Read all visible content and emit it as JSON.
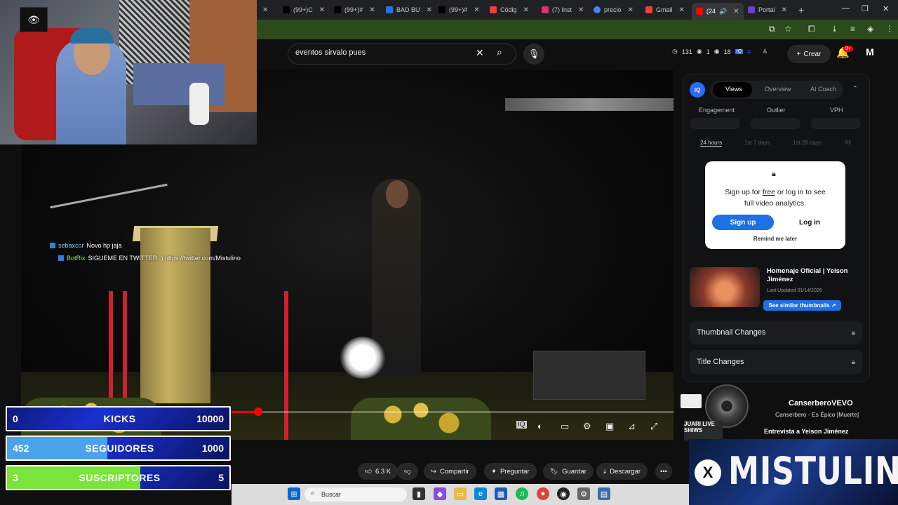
{
  "browser": {
    "tabs": [
      {
        "label": "(99+)C",
        "color": "#000000"
      },
      {
        "label": "(99+)#",
        "color": "#000000"
      },
      {
        "label": "BAD BU",
        "color": "#1877f2"
      },
      {
        "label": "(99+)#",
        "color": "#000000"
      },
      {
        "label": "Códig",
        "color": "#ea4335"
      },
      {
        "label": "(7) Inst",
        "color": "#e1306c"
      },
      {
        "label": "precio",
        "color": "#4285f4"
      },
      {
        "label": "Gmail",
        "color": "#ea4335"
      },
      {
        "label": "(24",
        "color": "#ff0000"
      },
      {
        "label": "Portal",
        "color": "#6a3fd0"
      }
    ]
  },
  "youtube": {
    "search_value": "eventos sirvalo pues",
    "stats": {
      "views": "131",
      "sep1": "1",
      "sep2": "18"
    },
    "create_label": "Crear",
    "notif_badge": "9+",
    "actions": {
      "likes": "6.3 K",
      "share": "Compartir",
      "ask": "Preguntar",
      "save": "Guardar",
      "download": "Descargar",
      "more": "•••"
    },
    "progress": 0.06
  },
  "chat": [
    {
      "user": "sebaxcor",
      "message": "Novo hp jaja"
    },
    {
      "user": "BotRix",
      "message": "SIGUEME EN TWITTER :) https://twitter.com/Mistulino"
    }
  ],
  "panel": {
    "logo": "IQ",
    "tabs": [
      "Views",
      "Overview",
      "AI Coach"
    ],
    "metrics": [
      "Engagement",
      "Outlier",
      "VPH"
    ],
    "ranges": [
      "24 hours",
      "1st 7 days",
      "1st 28 days",
      "All"
    ],
    "signup_pre": "Sign up for ",
    "signup_free": "free",
    "signup_post": " or log in to see full video analytics.",
    "signup_btn": "Sign up",
    "login_btn": "Log in",
    "remind": "Remind me later",
    "thumb_title": "Homenaje Oficial | Yeison Jiménez",
    "thumb_updated": "Last Updated 01/14/2026",
    "see_similar": "See similar thumbnails ↗",
    "thumbnail_changes": "Thumbnail Changes",
    "title_changes": "Title Changes"
  },
  "now_playing": {
    "artist": "CanserberoVEVO",
    "song": "Canserbero - Es Épico [Muerte]",
    "interview": "Entrevista a Yeison Jiménez",
    "thumb_label": "JUARI LIVE SHIWS"
  },
  "overlay": {
    "bars": [
      {
        "left": "0",
        "label": "KICKS",
        "right": "10000",
        "fill": 0.0,
        "color": "#1a2fd0"
      },
      {
        "left": "452",
        "label": "SEGUIDORES",
        "right": "1000",
        "fill": 0.452,
        "color": "#4aa3e8"
      },
      {
        "left": "3",
        "label": "SUSCRIPTORES",
        "right": "5",
        "fill": 0.6,
        "color": "#7ce33c"
      }
    ],
    "brand": "MISTULINO"
  },
  "taskbar": {
    "search_placeholder": "Buscar"
  }
}
